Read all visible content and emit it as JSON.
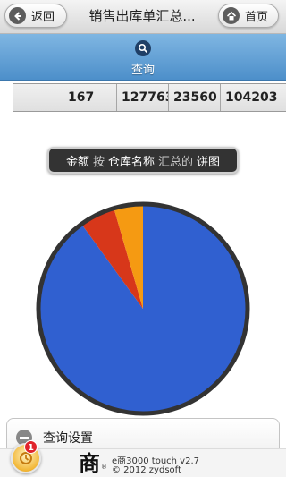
{
  "header": {
    "back_label": "返回",
    "title": "销售出库单汇总...",
    "home_label": "首页"
  },
  "query": {
    "label": "查询"
  },
  "summary_row": {
    "cells": [
      "",
      "167",
      "127763",
      "23560",
      "104203"
    ]
  },
  "chart_title": {
    "measure": "金额",
    "by": "按",
    "dimension": "仓库名称",
    "summarized": "汇总的",
    "chart_type": "饼图"
  },
  "chart_data": {
    "type": "pie",
    "slices": [
      {
        "value": 0.9,
        "color": "#3060d0"
      },
      {
        "value": 0.055,
        "color": "#d7371a"
      },
      {
        "value": 0.045,
        "color": "#f59a12"
      }
    ],
    "border_color": "#333333"
  },
  "settings": {
    "label": "查询设置"
  },
  "footer": {
    "logo_char": "商",
    "registered": "®",
    "version": "e商3000 touch v2.7",
    "copyright": "© 2012 zydsoft"
  },
  "notification": {
    "count": "1"
  },
  "icons": {
    "back": "arrow-left-icon",
    "home": "home-icon",
    "search": "search-icon",
    "collapse": "minus-icon",
    "notification": "notification-icon"
  }
}
